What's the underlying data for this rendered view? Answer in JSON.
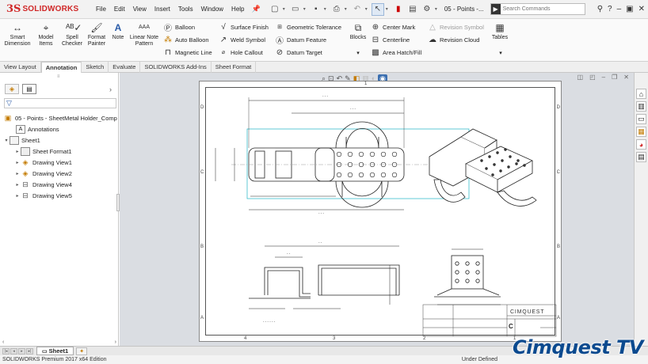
{
  "app": {
    "logo_mark": "3S",
    "logo_text": "SOLIDWORKS",
    "menu": [
      "File",
      "Edit",
      "View",
      "Insert",
      "Tools",
      "Window",
      "Help"
    ],
    "document_name": "05 - Points -...",
    "search_placeholder": "Search Commands",
    "help_label": "?",
    "icons": [
      "pin-icon",
      "new-icon",
      "open-icon",
      "save-icon",
      "print-icon",
      "undo-icon",
      "select-icon",
      "rebuild-icon",
      "file-properties-icon",
      "options-icon",
      "search-icon",
      "help-icon",
      "minimize-icon",
      "restore-icon",
      "close-icon"
    ]
  },
  "ribbon": {
    "large_buttons": [
      {
        "line1": "Smart",
        "line2": "Dimension",
        "icon": "smart-dimension-icon"
      },
      {
        "line1": "Model",
        "line2": "Items",
        "icon": "model-items-icon"
      },
      {
        "line1": "Spell",
        "line2": "Checker",
        "icon": "spell-checker-icon"
      },
      {
        "line1": "Format",
        "line2": "Painter",
        "icon": "format-painter-icon"
      },
      {
        "line1": "Note",
        "line2": "",
        "icon": "note-icon"
      },
      {
        "line1": "Linear Note",
        "line2": "Pattern",
        "icon": "linear-note-pattern-icon"
      }
    ],
    "col1": [
      "Balloon",
      "Auto Balloon",
      "Magnetic Line"
    ],
    "col2": [
      "Surface Finish",
      "Weld Symbol",
      "Hole Callout"
    ],
    "col3": [
      "Geometric Tolerance",
      "Datum Feature",
      "Datum Target"
    ],
    "blocks_label": "Blocks",
    "col4": [
      "Center Mark",
      "Centerline",
      "Area Hatch/Fill"
    ],
    "col5": [
      "Revision Symbol",
      "Revision Cloud"
    ],
    "tables_label": "Tables"
  },
  "tabs": [
    "View Layout",
    "Annotation",
    "Sketch",
    "Evaluate",
    "SOLIDWORKS Add-Ins",
    "Sheet Format"
  ],
  "active_tab": "Annotation",
  "tree": {
    "root": "05 - Points - SheetMetal Holder_Comp",
    "items": [
      {
        "label": "Annotations",
        "level": 1,
        "expander": ""
      },
      {
        "label": "Sheet1",
        "level": 1,
        "expander": "▾"
      },
      {
        "label": "Sheet Format1",
        "level": 2,
        "expander": "▸"
      },
      {
        "label": "Drawing View1",
        "level": 2,
        "expander": "▸"
      },
      {
        "label": "Drawing View2",
        "level": 2,
        "expander": "▸"
      },
      {
        "label": "Drawing View4",
        "level": 2,
        "expander": "▸"
      },
      {
        "label": "Drawing View5",
        "level": 2,
        "expander": "▸"
      }
    ]
  },
  "drawing": {
    "zones_top": [
      "1"
    ],
    "zones_bottom": [
      "4",
      "3",
      "2",
      "1"
    ],
    "zones_left": [
      "D",
      "C",
      "B",
      "A"
    ],
    "zones_right": [
      "D",
      "C",
      "B",
      "A"
    ],
    "title_block_company": "CIMQUEST",
    "title_block_size": "C"
  },
  "sheet_tab": "Sheet1",
  "status": {
    "edition": "SOLIDWORKS Premium 2017 x64 Edition",
    "definition": "Under Defined"
  },
  "watermark": "Cimquest TV",
  "colors": {
    "brand_red": "#d02828",
    "selection_blue": "#3b6fb0",
    "watermark_blue": "#0b4a8f",
    "view_border_cyan": "#1fb5c6"
  }
}
